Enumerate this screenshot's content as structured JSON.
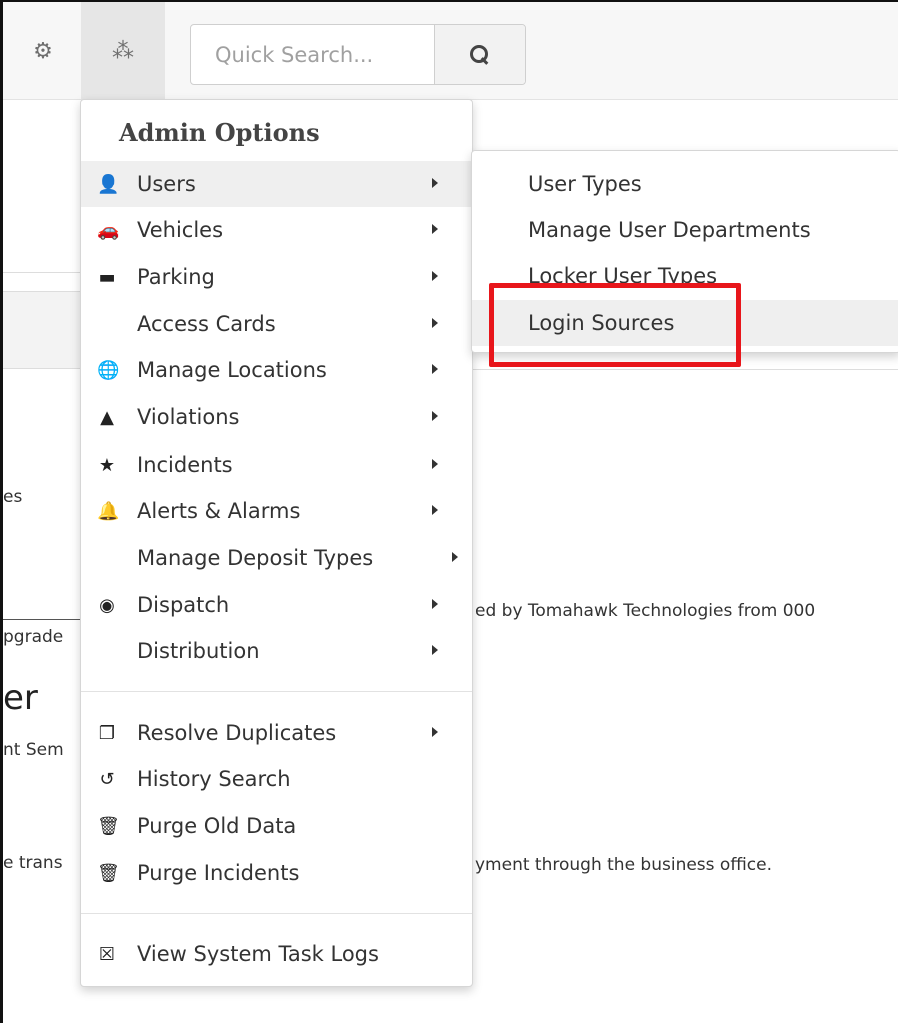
{
  "topbar": {
    "gears_icon": "gears-icon",
    "admin_icon": "cubes-icon",
    "search": {
      "placeholder": "Quick Search...",
      "value": ""
    }
  },
  "background": {
    "frag_es": "es",
    "frag_upgrade": "pgrade",
    "frag_heading": "er",
    "frag_sem": "nt Sem",
    "frag_trans": "e trans",
    "frag_tomahawk": "ed by Tomahawk Technologies from 000",
    "frag_payment": "yment through the business office."
  },
  "admin_menu": {
    "header": "Admin Options",
    "groups": [
      [
        {
          "icon": "user-icon",
          "label": "Users",
          "submenu": true,
          "active": true
        },
        {
          "icon": "car-icon",
          "label": "Vehicles",
          "submenu": true
        },
        {
          "icon": "parking-icon",
          "label": "Parking",
          "submenu": true
        },
        {
          "icon": "",
          "label": "Access Cards",
          "submenu": true
        },
        {
          "icon": "globe-icon",
          "label": "Manage Locations",
          "submenu": true
        },
        {
          "icon": "warning-icon",
          "label": "Violations",
          "submenu": true
        },
        {
          "icon": "star-icon",
          "label": "Incidents",
          "submenu": true
        },
        {
          "icon": "bell-icon",
          "label": "Alerts & Alarms",
          "submenu": true
        },
        {
          "icon": "",
          "label": "Manage Deposit Types",
          "submenu": true
        },
        {
          "icon": "podcast-icon",
          "label": "Dispatch",
          "submenu": true
        },
        {
          "icon": "",
          "label": "Distribution",
          "submenu": true
        }
      ],
      [
        {
          "icon": "copy-icon",
          "label": "Resolve Duplicates",
          "submenu": true
        },
        {
          "icon": "history-icon",
          "label": "History Search",
          "submenu": false
        },
        {
          "icon": "trash-icon",
          "label": "Purge Old Data",
          "submenu": false
        },
        {
          "icon": "trash-icon",
          "label": "Purge Incidents",
          "submenu": false
        }
      ],
      [
        {
          "icon": "calendar-x-icon",
          "label": "View System Task Logs",
          "submenu": false
        }
      ]
    ]
  },
  "users_submenu": {
    "items": [
      {
        "label": "User Types"
      },
      {
        "label": "Manage User Departments"
      },
      {
        "label": "Locker User Types"
      },
      {
        "label": "Login Sources",
        "hover": true,
        "highlighted": true
      }
    ]
  },
  "colors": {
    "highlight": "#e8161b",
    "topbar_bg": "#f7f7f7",
    "active_bg": "#efefef"
  }
}
